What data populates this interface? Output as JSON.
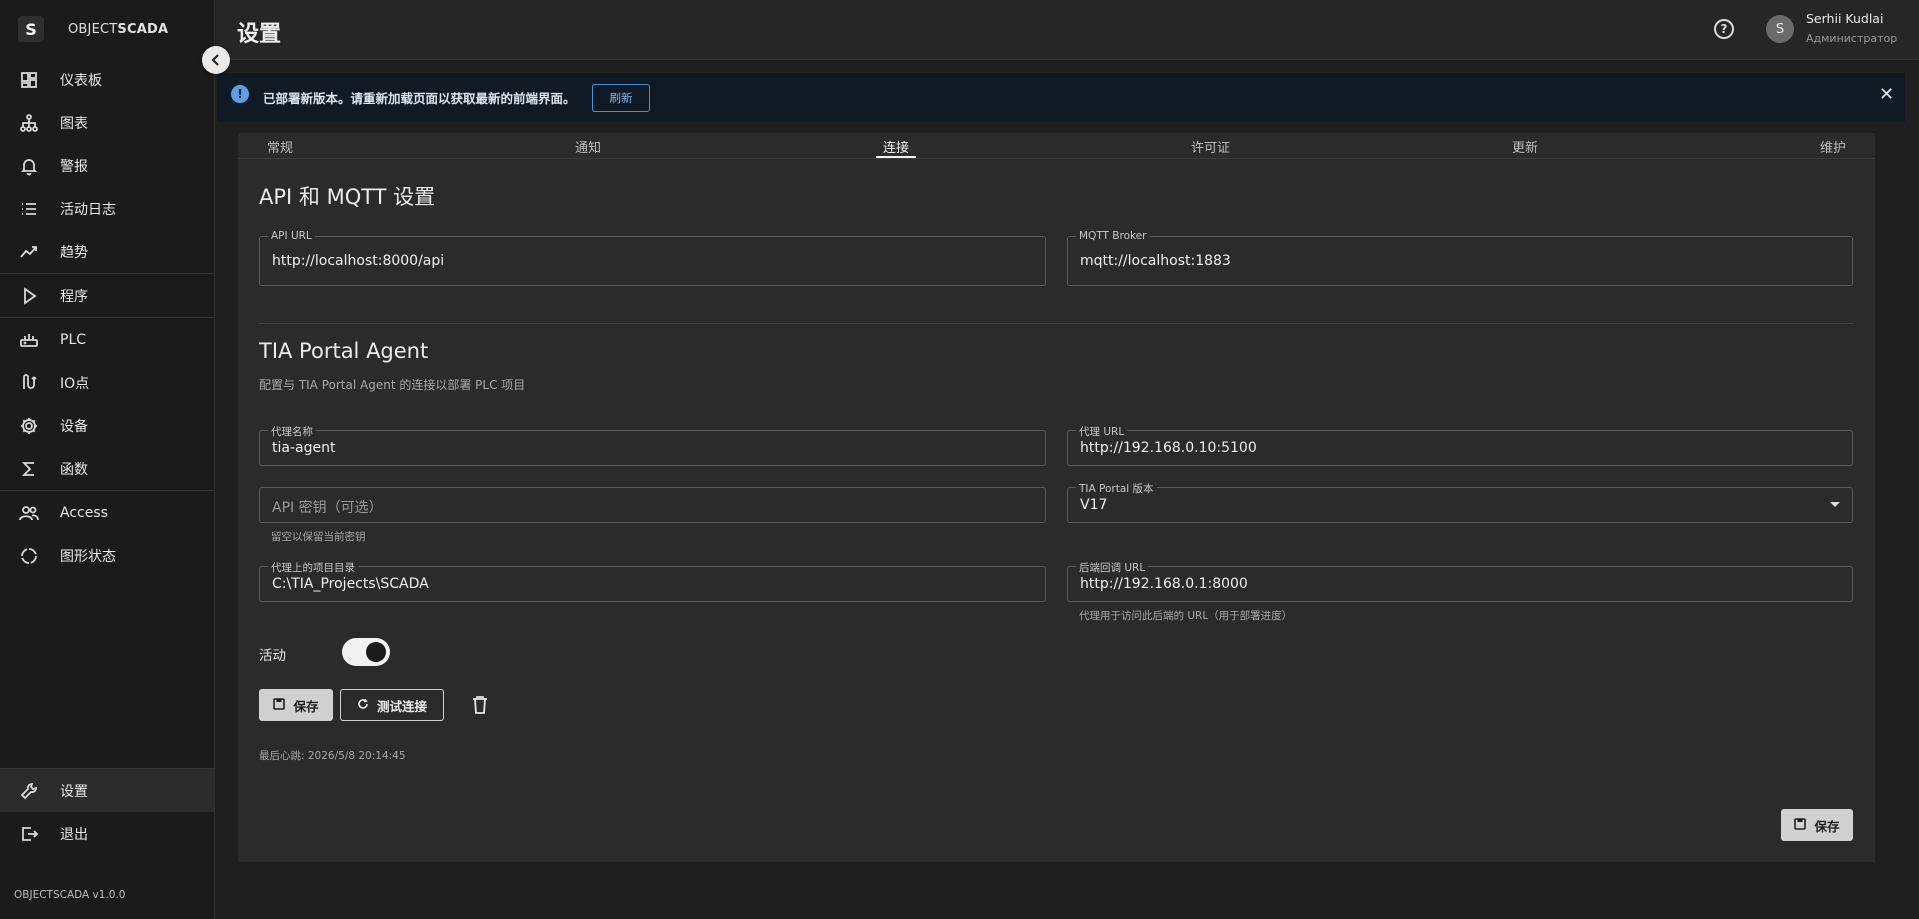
{
  "app": {
    "brand_prefix": "OBJECT",
    "brand_suffix": "SCADA",
    "brand_logo_letter": "S",
    "version": "OBJECTSCADA v1.0.0"
  },
  "sidebar": {
    "items": [
      {
        "label": "仪表板",
        "icon": "dashboard-icon"
      },
      {
        "label": "图表",
        "icon": "hierarchy-icon"
      },
      {
        "label": "警报",
        "icon": "bell-icon"
      },
      {
        "label": "活动日志",
        "icon": "list-icon"
      },
      {
        "label": "趋势",
        "icon": "trend-icon"
      },
      {
        "label": "程序",
        "icon": "play-icon"
      },
      {
        "label": "PLC",
        "icon": "router-icon"
      },
      {
        "label": "IO点",
        "icon": "io-icon"
      },
      {
        "label": "设备",
        "icon": "gear-icon"
      },
      {
        "label": "函数",
        "icon": "sigma-icon"
      },
      {
        "label": "Access",
        "icon": "users-icon"
      },
      {
        "label": "图形状态",
        "icon": "cycle-icon"
      }
    ],
    "bottom": [
      {
        "label": "设置",
        "icon": "wrench-icon"
      },
      {
        "label": "退出",
        "icon": "logout-icon"
      }
    ]
  },
  "header": {
    "title": "设置",
    "user_initial": "S",
    "user_name": "Serhii Kudlai",
    "user_role": "Администратор"
  },
  "banner": {
    "text": "已部署新版本。请重新加载页面以获取最新的前端界面。",
    "button": "刷新",
    "close": "✕"
  },
  "tabs": [
    "常规",
    "通知",
    "连接",
    "许可证",
    "更新",
    "维护"
  ],
  "active_tab": "连接",
  "api_section": {
    "title": "API 和 MQTT 设置",
    "api_url_label": "API URL",
    "api_url_value": "http://localhost:8000/api",
    "mqtt_label": "MQTT Broker",
    "mqtt_value": "mqtt://localhost:1883"
  },
  "tia_section": {
    "title": "TIA Portal Agent",
    "description": "配置与 TIA Portal Agent 的连接以部署 PLC 项目",
    "agent_name_label": "代理名称",
    "agent_name_value": "tia-agent",
    "agent_url_label": "代理 URL",
    "agent_url_value": "http://192.168.0.10:5100",
    "api_key_placeholder": "API 密钥（可选）",
    "api_key_helper": "留空以保留当前密钥",
    "tia_version_label": "TIA Portal 版本",
    "tia_version_value": "V17",
    "project_dir_label": "代理上的项目目录",
    "project_dir_value": "C:\\TIA_Projects\\SCADA",
    "callback_label": "后端回调 URL",
    "callback_value": "http://192.168.0.1:8000",
    "callback_helper": "代理用于访问此后端的 URL（用于部署进度）",
    "active_label": "活动",
    "active_on": true,
    "save_label": "保存",
    "test_label": "测试连接",
    "heartbeat": "最后心跳: 2026/5/8 20:14:45"
  },
  "footer": {
    "save_label": "保存"
  }
}
